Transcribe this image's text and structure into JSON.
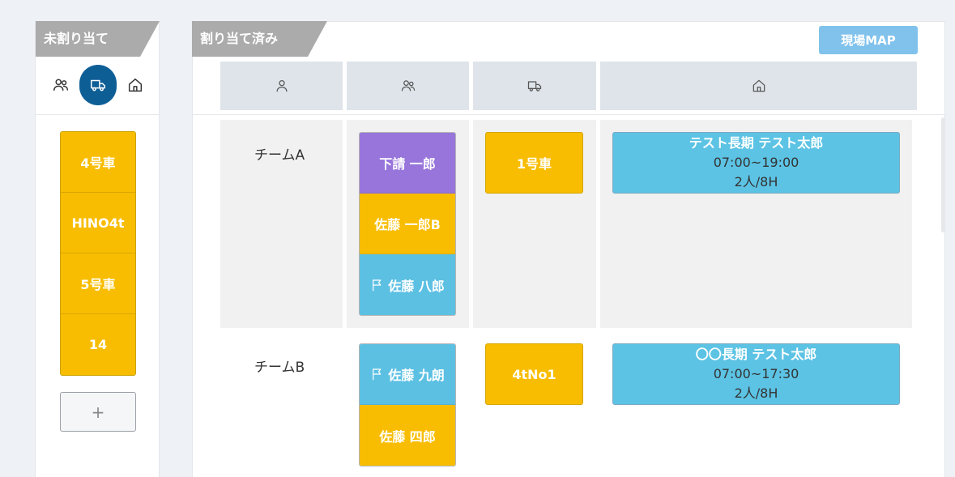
{
  "unassigned": {
    "tag": "未割り当て",
    "tabs": [
      {
        "name": "people",
        "icon": "people-icon",
        "active": false
      },
      {
        "name": "truck",
        "icon": "truck-icon",
        "active": true
      },
      {
        "name": "home",
        "icon": "home-icon",
        "active": false
      }
    ],
    "vehicles": [
      "4号車",
      "HINO4t",
      "5号車",
      "14"
    ],
    "add_label": "+"
  },
  "assigned": {
    "tag": "割り当て済み",
    "map_button": "現場MAP",
    "columns": [
      {
        "icon": "person-icon"
      },
      {
        "icon": "people-icon"
      },
      {
        "icon": "truck-icon"
      },
      {
        "icon": "home-icon"
      }
    ],
    "teams": [
      {
        "name": "チームA",
        "members": [
          {
            "label": "下請 一郎",
            "color": "#9775db",
            "flag": false
          },
          {
            "label": "佐藤 一郎B",
            "color": "#f8bd00",
            "flag": false
          },
          {
            "label": "佐藤 八郎",
            "color": "#5cc0e3",
            "flag": true
          }
        ],
        "vehicle": "1号車",
        "site": {
          "title": "テスト長期  テスト太郎",
          "time": "07:00~19:00",
          "workload": "2人/8H"
        }
      },
      {
        "name": "チームB",
        "members": [
          {
            "label": "佐藤 九朗",
            "color": "#5cc0e3",
            "flag": true
          },
          {
            "label": "佐藤 四郎",
            "color": "#f8bd00",
            "flag": false
          }
        ],
        "vehicle": "4tNo1",
        "site": {
          "title": "〇〇長期  テスト太郎",
          "time": "07:00~17:30",
          "workload": "2人/8H"
        }
      }
    ]
  },
  "colors": {
    "vehicle_yellow": "#f8bd00",
    "site_blue": "#5cc3e4",
    "member_purple": "#9775db",
    "active_tab": "#0e5e96",
    "tag_gray": "#ababab",
    "map_button": "#80c2ec"
  }
}
